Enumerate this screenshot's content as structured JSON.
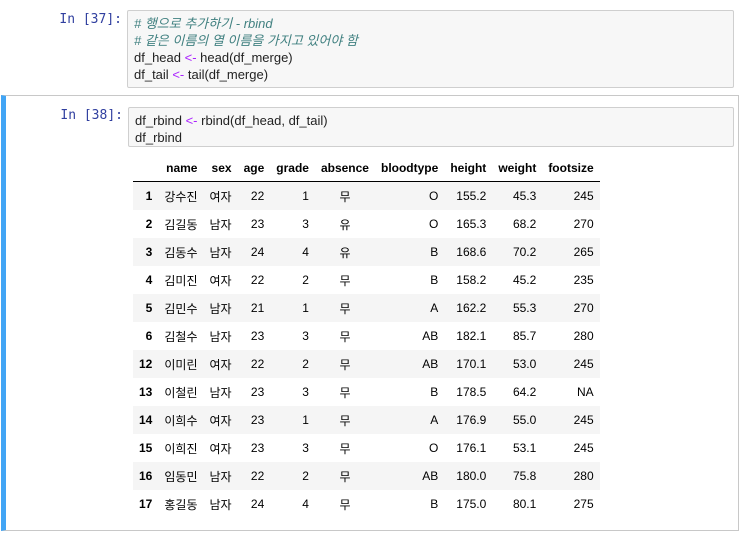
{
  "cell1": {
    "prompt": "In [37]:",
    "comment1": "# 행으로 추가하기 - rbind",
    "comment2": "# 같은 이름의 열 이름을 가지고 있어야 함",
    "line3": {
      "a": "df_head ",
      "op": "<-",
      "b": " head(df_merge)"
    },
    "line4": {
      "a": "df_tail ",
      "op": "<-",
      "b": " tail(df_merge)"
    }
  },
  "cell2": {
    "prompt": "In [38]:",
    "line1": {
      "a": "df_rbind ",
      "op": "<-",
      "b": " rbind(df_head, df_tail)"
    },
    "line2": "df_rbind"
  },
  "table": {
    "columns": [
      "",
      "name",
      "sex",
      "age",
      "grade",
      "absence",
      "bloodtype",
      "height",
      "weight",
      "footsize"
    ],
    "rows": [
      [
        "1",
        "강수진",
        "여자",
        "22",
        "1",
        "무",
        "O",
        "155.2",
        "45.3",
        "245"
      ],
      [
        "2",
        "김길동",
        "남자",
        "23",
        "3",
        "유",
        "O",
        "165.3",
        "68.2",
        "270"
      ],
      [
        "3",
        "김동수",
        "남자",
        "24",
        "4",
        "유",
        "B",
        "168.6",
        "70.2",
        "265"
      ],
      [
        "4",
        "김미진",
        "여자",
        "22",
        "2",
        "무",
        "B",
        "158.2",
        "45.2",
        "235"
      ],
      [
        "5",
        "김민수",
        "남자",
        "21",
        "1",
        "무",
        "A",
        "162.2",
        "55.3",
        "270"
      ],
      [
        "6",
        "김철수",
        "남자",
        "23",
        "3",
        "무",
        "AB",
        "182.1",
        "85.7",
        "280"
      ],
      [
        "12",
        "이미린",
        "여자",
        "22",
        "2",
        "무",
        "AB",
        "170.1",
        "53.0",
        "245"
      ],
      [
        "13",
        "이철린",
        "남자",
        "23",
        "3",
        "무",
        "B",
        "178.5",
        "64.2",
        "NA"
      ],
      [
        "14",
        "이희수",
        "여자",
        "23",
        "1",
        "무",
        "A",
        "176.9",
        "55.0",
        "245"
      ],
      [
        "15",
        "이희진",
        "여자",
        "23",
        "3",
        "무",
        "O",
        "176.1",
        "53.1",
        "245"
      ],
      [
        "16",
        "임동민",
        "남자",
        "22",
        "2",
        "무",
        "AB",
        "180.0",
        "75.8",
        "280"
      ],
      [
        "17",
        "홍길동",
        "남자",
        "24",
        "4",
        "무",
        "B",
        "175.0",
        "80.1",
        "275"
      ]
    ]
  },
  "colors": {
    "selected_cell_bar": "#42a5f5",
    "prompt": "#303f9f",
    "comment": "#408080",
    "operator": "#aa22ff"
  }
}
